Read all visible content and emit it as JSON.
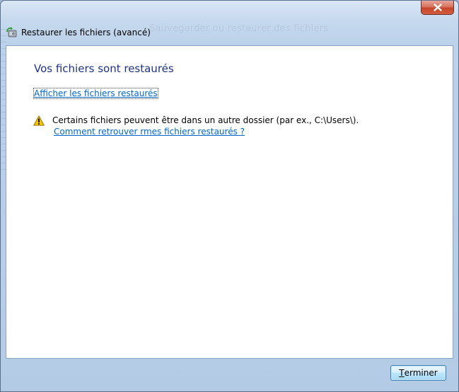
{
  "window": {
    "title": "Restaurer les fichiers (avancé)",
    "background_ghost_text": "Sauvegarder ou restaurer des fichiers"
  },
  "content": {
    "heading": "Vos fichiers sont restaurés",
    "show_files_link": "Afficher les fichiers restaurés",
    "warning_text": "Certains fichiers peuvent être dans un autre dossier (par ex., C:\\Users\\).",
    "help_link": "Comment retrouver rmes fichiers restaurés ?"
  },
  "footer": {
    "finish_button_accel": "T",
    "finish_button_rest": "erminer"
  },
  "icons": {
    "title": "backup-restore-icon",
    "warning": "warning-icon",
    "close": "close-icon"
  },
  "colors": {
    "heading": "#1e3287",
    "link": "#0066cc",
    "close_button": "#c7452c",
    "warning": "#f5c400"
  }
}
